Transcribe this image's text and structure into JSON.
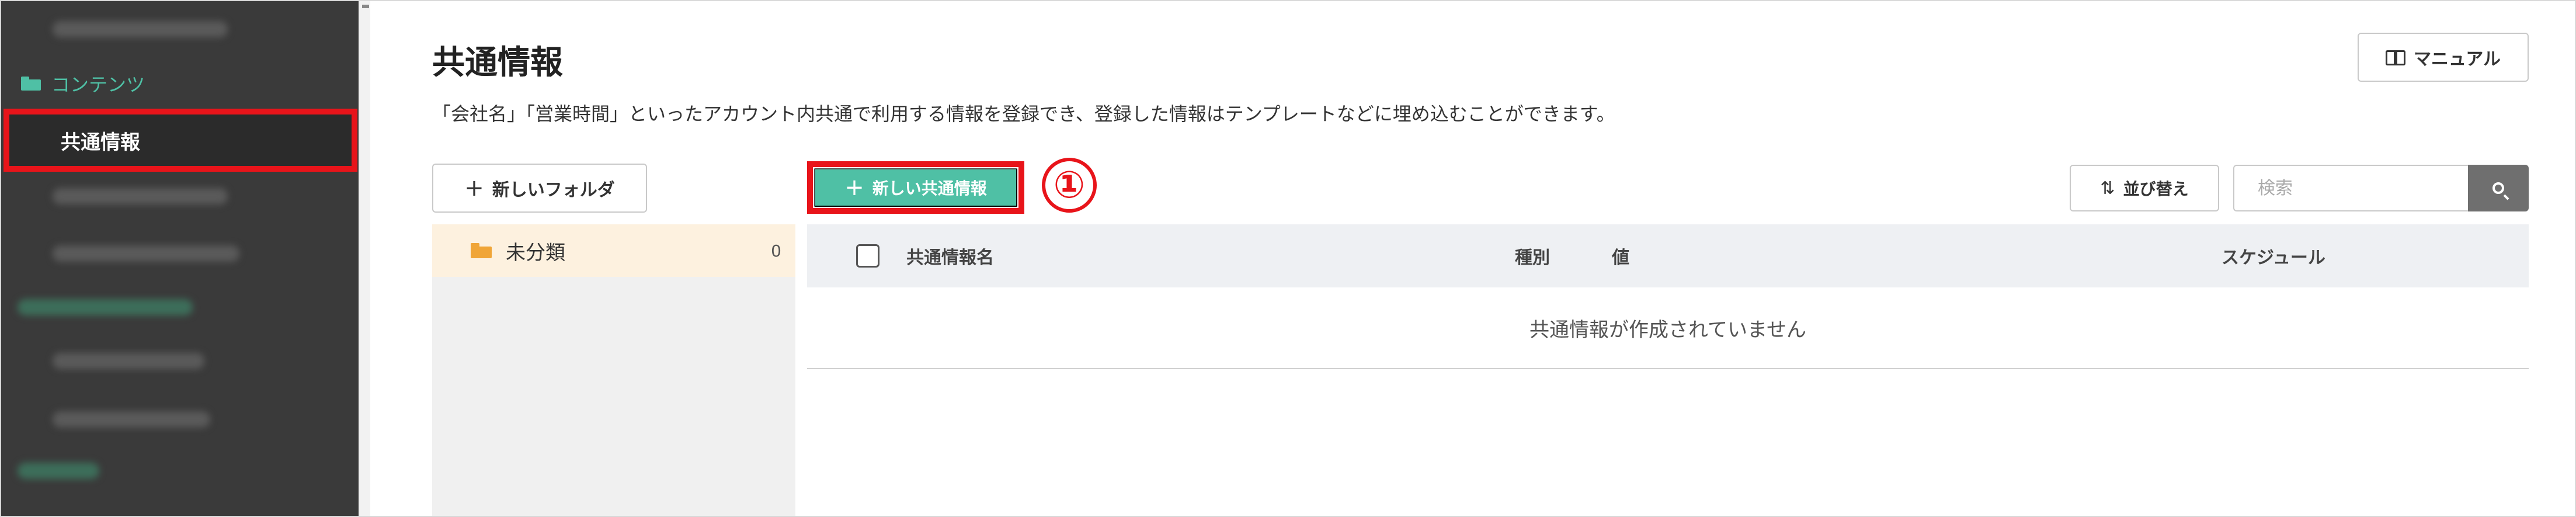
{
  "sidebar": {
    "section_label": "コンテンツ",
    "section_icon": "folder-icon",
    "active_item_label": "共通情報",
    "accent_color": "#4fc0a5",
    "highlight_color": "#e8141a"
  },
  "header": {
    "title": "共通情報",
    "description": "「会社名」「営業時間」といったアカウント内共通で利用する情報を登録でき、登録した情報はテンプレートなどに埋め込むことができます。",
    "manual_button": {
      "label": "マニュアル",
      "icon": "book-icon"
    }
  },
  "toolbar": {
    "new_folder_label": "新しいフォルダ",
    "new_info_label": "新しい共通情報",
    "callout_number": "①",
    "sort_label": "並び替え",
    "sort_icon": "sort-arrows-icon",
    "search_placeholder": "検索",
    "search_icon": "search-icon"
  },
  "folders": [
    {
      "name": "未分類",
      "count": "0",
      "color": "#f0a537"
    }
  ],
  "table": {
    "columns": [
      "共通情報名",
      "種別",
      "値",
      "スケジュール"
    ],
    "empty_message": "共通情報が作成されていません"
  }
}
